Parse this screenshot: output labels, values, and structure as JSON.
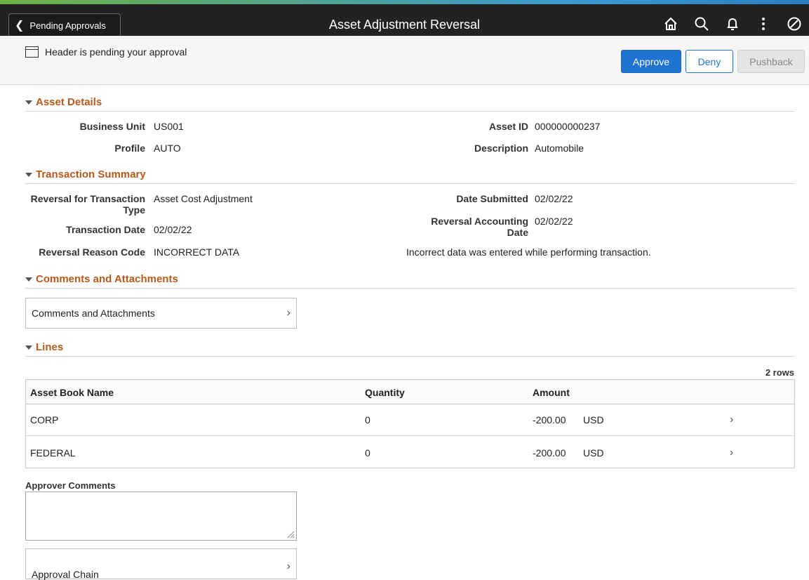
{
  "banner": {
    "back_label": "Pending Approvals",
    "title": "Asset Adjustment Reversal",
    "icons": [
      "home-icon",
      "search-icon",
      "bell-icon",
      "kebab-menu-icon",
      "compass-icon"
    ]
  },
  "subbar": {
    "pending_text": "Header is pending your approval",
    "approve_label": "Approve",
    "deny_label": "Deny",
    "pushback_label": "Pushback"
  },
  "asset_details": {
    "heading": "Asset Details",
    "business_unit_label": "Business Unit",
    "business_unit": "US001",
    "asset_id_label": "Asset ID",
    "asset_id": "000000000237",
    "profile_label": "Profile",
    "profile": "AUTO",
    "description_label": "Description",
    "description": "Automobile"
  },
  "transaction_summary": {
    "heading": "Transaction Summary",
    "reversal_type_label_1": "Reversal for Transaction",
    "reversal_type_label_2": "Type",
    "reversal_type": "Asset Cost Adjustment",
    "date_submitted_label": "Date Submitted",
    "date_submitted": "02/02/22",
    "transaction_date_label": "Transaction Date",
    "transaction_date": "02/02/22",
    "reversal_accounting_label_1": "Reversal Accounting",
    "reversal_accounting_label_2": "Date",
    "reversal_accounting_date": "02/02/22",
    "reason_code_label": "Reversal Reason Code",
    "reason_code": "INCORRECT DATA",
    "reason_text": "Incorrect data was entered while performing transaction."
  },
  "comments": {
    "heading": "Comments and Attachments",
    "link_label": "Comments and Attachments"
  },
  "lines": {
    "heading": "Lines",
    "row_count": "2 rows",
    "columns": [
      "Asset Book Name",
      "Quantity",
      "Amount"
    ],
    "rows": [
      {
        "book": "CORP",
        "quantity": "0",
        "amount": "-200.00",
        "currency": "USD"
      },
      {
        "book": "FEDERAL",
        "quantity": "0",
        "amount": "-200.00",
        "currency": "USD"
      }
    ]
  },
  "approver": {
    "label": "Approver Comments",
    "value": ""
  },
  "approval_chain": {
    "label": "Approval Chain"
  }
}
